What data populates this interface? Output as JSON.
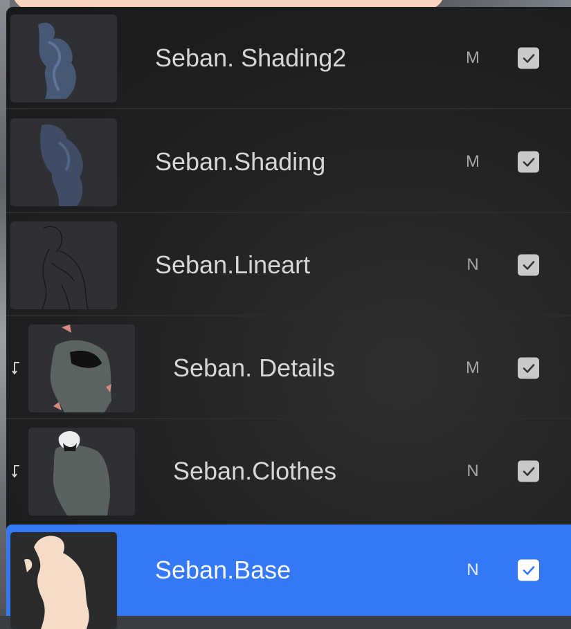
{
  "layers": [
    {
      "name": "Seban. Shading2",
      "mode": "M",
      "visible": true,
      "clipped": false,
      "selected": false,
      "thumb": "shading2-thumbnail"
    },
    {
      "name": "Seban.Shading",
      "mode": "M",
      "visible": true,
      "clipped": false,
      "selected": false,
      "thumb": "shading-thumbnail"
    },
    {
      "name": "Seban.Lineart",
      "mode": "N",
      "visible": true,
      "clipped": false,
      "selected": false,
      "thumb": "lineart-thumbnail"
    },
    {
      "name": "Seban. Details",
      "mode": "M",
      "visible": true,
      "clipped": true,
      "selected": false,
      "thumb": "details-thumbnail"
    },
    {
      "name": "Seban.Clothes",
      "mode": "N",
      "visible": true,
      "clipped": true,
      "selected": false,
      "thumb": "clothes-thumbnail"
    },
    {
      "name": "Seban.Base",
      "mode": "N",
      "visible": true,
      "clipped": false,
      "selected": true,
      "thumb": "base-thumbnail"
    }
  ],
  "colors": {
    "selected": "#3478f6",
    "panel": "#1f2022",
    "top_tab": "#fbd3bd",
    "base_silhouette": "#f5dcc6",
    "clothes": "#5a6260",
    "shading": "#4a5a78"
  },
  "icons": {
    "visibility": "checkbox-check-icon",
    "clipping": "clip-arrow-icon"
  }
}
